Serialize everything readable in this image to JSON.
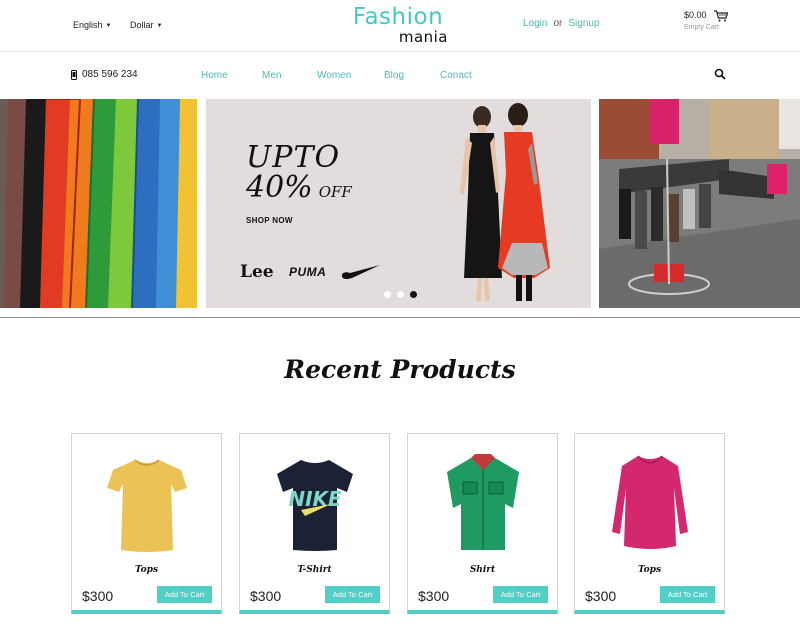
{
  "header": {
    "language": "English",
    "currency": "Dollar",
    "logo_top": "Fashion",
    "logo_bottom": "mania",
    "login": "Login",
    "or": "or",
    "signup": "Signup",
    "cart_amount": "$0.00",
    "cart_status": "Empty Cart"
  },
  "navbar": {
    "phone": "085 596 234",
    "items": [
      "Home",
      "Men",
      "Women",
      "Blog",
      "Conact"
    ]
  },
  "banner": {
    "line1": "UPTO",
    "line2": "40%",
    "off": "OFF",
    "cta": "SHOP NOW",
    "brands": [
      "Lee",
      "PUMA"
    ],
    "slides": 3,
    "active_slide": 3
  },
  "section": {
    "title": "Recent Products"
  },
  "products": [
    {
      "name": "Tops",
      "price": "$300",
      "button": "Add To Cart",
      "color": "#ecc256"
    },
    {
      "name": "T-Shirt",
      "price": "$300",
      "button": "Add To Cart",
      "color": "#1c2236"
    },
    {
      "name": "Shirt",
      "price": "$300",
      "button": "Add To Cart",
      "color": "#1e9a62"
    },
    {
      "name": "Tops",
      "price": "$300",
      "button": "Add To Cart",
      "color": "#d4286e"
    }
  ],
  "colors": {
    "accent": "#45c9c0",
    "button": "#51cfc6"
  }
}
